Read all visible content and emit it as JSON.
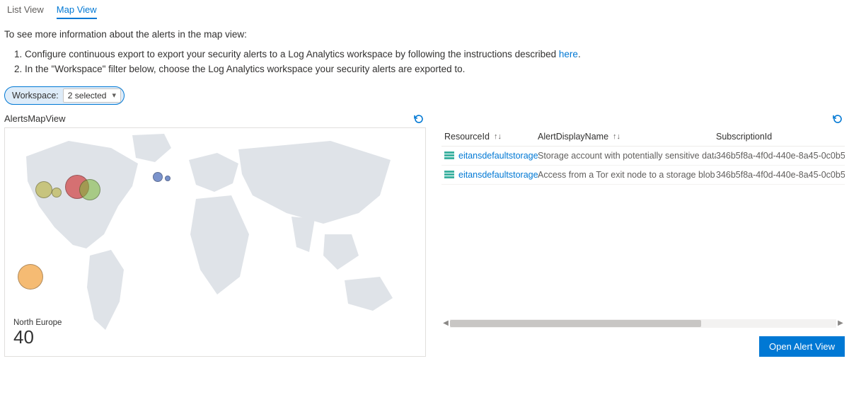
{
  "tabs": {
    "list": "List View",
    "map": "Map View"
  },
  "intro": "To see more information about the alerts in the map view:",
  "steps": {
    "s1_pre": "1. Configure continuous export to export your security alerts to a Log Analytics workspace by following the instructions described ",
    "s1_link": "here",
    "s1_post": ".",
    "s2": "2. In the \"Workspace\" filter below, choose the Log Analytics workspace your security alerts are exported to."
  },
  "filter": {
    "label": "Workspace:",
    "value": "2 selected"
  },
  "mapPane": {
    "title": "AlertsMapView",
    "statRegion": "North Europe",
    "statValue": "40"
  },
  "table": {
    "headers": {
      "resource": "ResourceId",
      "alert": "AlertDisplayName",
      "sub": "SubscriptionId"
    },
    "rows": [
      {
        "resource": "eitansdefaultstorage",
        "alert": "Storage account with potentially sensitive data has ...",
        "sub": "346b5f8a-4f0d-440e-8a45-0c0b5"
      },
      {
        "resource": "eitansdefaultstorage",
        "alert": "Access from a Tor exit node to a storage blob conta...",
        "sub": "346b5f8a-4f0d-440e-8a45-0c0b5"
      }
    ]
  },
  "button": "Open Alert View",
  "chart_data": {
    "type": "bubble-map",
    "title": "AlertsMapView",
    "annotation": {
      "label": "North Europe",
      "value": 40
    },
    "points": [
      {
        "region": "West US / Pacific NW",
        "approx_lat": 47,
        "approx_lon": -123,
        "size": "medium",
        "color": "#b8b13c"
      },
      {
        "region": "West US 2",
        "approx_lat": 45,
        "approx_lon": -120,
        "size": "small",
        "color": "#b8b13c"
      },
      {
        "region": "Central US (large)",
        "approx_lat": 42,
        "approx_lon": -96,
        "size": "large",
        "color": "#d02f2f"
      },
      {
        "region": "Central US (overlay)",
        "approx_lat": 41,
        "approx_lon": -90,
        "size": "medium-large",
        "color": "#7db83c"
      },
      {
        "region": "North Europe (blue)",
        "approx_lat": 53,
        "approx_lon": 0,
        "size": "small",
        "color": "#3b5fb3"
      },
      {
        "region": "North Europe (small)",
        "approx_lat": 53,
        "approx_lon": 3,
        "size": "x-small",
        "color": "#3b5fb3"
      },
      {
        "region": "Unassigned (bottom-left orange)",
        "approx_lat": null,
        "approx_lon": null,
        "size": "large",
        "color": "#f09b2f"
      }
    ]
  }
}
